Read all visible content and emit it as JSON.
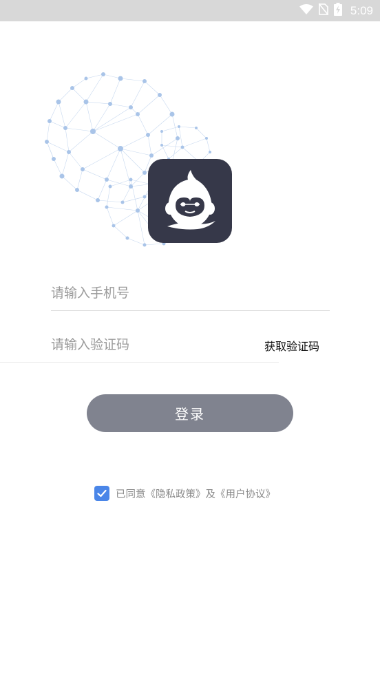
{
  "status_bar": {
    "time": "5:09",
    "icons": [
      "wifi-icon",
      "no-sim-icon",
      "battery-charging-icon"
    ]
  },
  "hero": {
    "background": "network-globe-graphic",
    "logo": "monkey-mascot-icon",
    "logo_bg_color": "#363849"
  },
  "form": {
    "phone_placeholder": "请输入手机号",
    "code_placeholder": "请输入验证码",
    "get_code_label": "获取验证码",
    "login_label": "登录"
  },
  "agreement": {
    "checked": true,
    "prefix": "已同意",
    "privacy_link": "《隐私政策》",
    "joiner": "及",
    "terms_link": "《用户协议》"
  },
  "colors": {
    "status_bar": "#d8d8d8",
    "login_button": "#80838f",
    "checkbox": "#4a86e8",
    "network_dots": "#a9c4e8"
  }
}
